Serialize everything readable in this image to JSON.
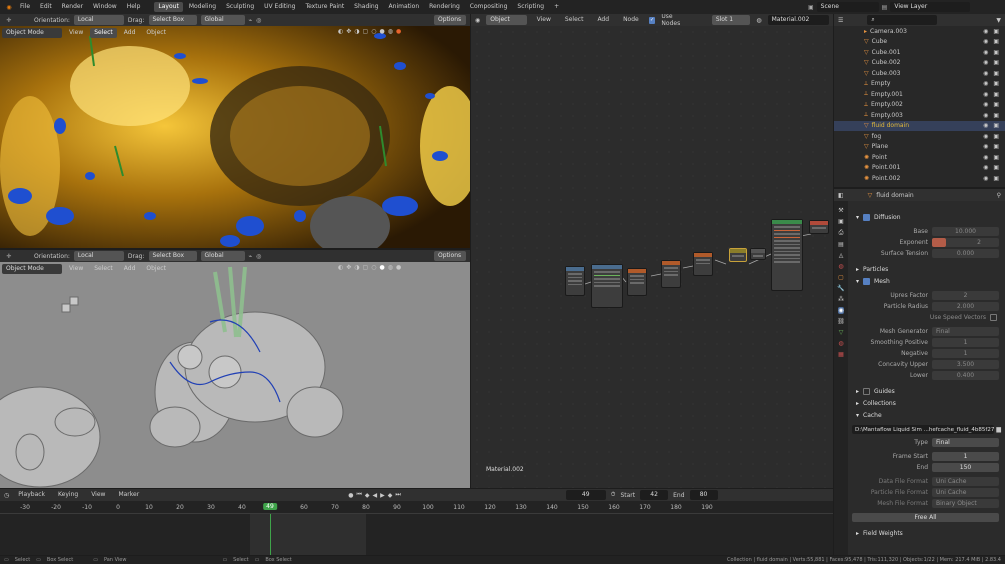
{
  "topbar": {
    "menus": [
      "File",
      "Edit",
      "Render",
      "Window",
      "Help"
    ],
    "workspaces": [
      "Layout",
      "Modeling",
      "Sculpting",
      "UV Editing",
      "Texture Paint",
      "Shading",
      "Animation",
      "Rendering",
      "Compositing",
      "Scripting"
    ],
    "active": "Layout",
    "scene": "Scene",
    "view_layer": "View Layer"
  },
  "viewport1": {
    "orientation_label": "Orientation:",
    "orientation": "Local",
    "drag_label": "Drag:",
    "drag": "Select Box",
    "transform": "Global",
    "options": "Options",
    "mode": "Object Mode",
    "menus": [
      "View",
      "Select",
      "Add",
      "Object"
    ]
  },
  "viewport2": {
    "orientation_label": "Orientation:",
    "orientation": "Local",
    "drag_label": "Drag:",
    "drag": "Select Box",
    "transform": "Global",
    "options": "Options",
    "mode": "Object Mode",
    "menus": [
      "View",
      "Select",
      "Add",
      "Object"
    ]
  },
  "node_editor": {
    "type": "Object",
    "menus": [
      "View",
      "Select",
      "Add",
      "Node"
    ],
    "use_nodes": "Use Nodes",
    "slot": "Slot 1",
    "material": "Material.002",
    "footer_label": "Material.002"
  },
  "outliner": {
    "items": [
      {
        "name": "Camera.003"
      },
      {
        "name": "Cube"
      },
      {
        "name": "Cube.001"
      },
      {
        "name": "Cube.002"
      },
      {
        "name": "Cube.003"
      },
      {
        "name": "Empty"
      },
      {
        "name": "Empty.001"
      },
      {
        "name": "Empty.002"
      },
      {
        "name": "Empty.003"
      },
      {
        "name": "fluid domain",
        "selected": true
      },
      {
        "name": "fog"
      },
      {
        "name": "Plane"
      },
      {
        "name": "Point"
      },
      {
        "name": "Point.001"
      },
      {
        "name": "Point.002"
      }
    ]
  },
  "properties": {
    "object_name": "fluid domain",
    "diffusion": {
      "title": "Diffusion",
      "base_label": "Base",
      "base": "10.000",
      "exponent_label": "Exponent",
      "exponent": "2",
      "surface_tension_label": "Surface Tension",
      "surface_tension": "0.000"
    },
    "particles": "Particles",
    "mesh": {
      "title": "Mesh",
      "upres_label": "Upres Factor",
      "upres": "2",
      "radius_label": "Particle Radius",
      "radius": "2.000",
      "speed_vectors": "Use Speed Vectors",
      "generator_label": "Mesh Generator",
      "generator": "Final",
      "smoothing_pos_label": "Smoothing Positive",
      "smoothing_pos": "1",
      "negative_label": "Negative",
      "negative": "1",
      "concavity_upper_label": "Concavity Upper",
      "concavity_upper": "3.500",
      "lower_label": "Lower",
      "lower": "0.400"
    },
    "guides": "Guides",
    "collections": "Collections",
    "cache": {
      "title": "Cache",
      "path": "D:\\Mantaflow Liquid Sim ...hefcache_fluid_4b85f272",
      "type_label": "Type",
      "type": "Final",
      "frame_start_label": "Frame Start",
      "frame_start": "1",
      "end_label": "End",
      "end": "150",
      "data_format_label": "Data File Format",
      "data_format": "Uni Cache",
      "particle_format_label": "Particle File Format",
      "particle_format": "Uni Cache",
      "mesh_format_label": "Mesh File Format",
      "mesh_format": "Binary Object",
      "free_all": "Free All"
    },
    "field_weights": "Field Weights"
  },
  "timeline": {
    "menus": [
      "Playback",
      "Keying",
      "View",
      "Marker"
    ],
    "current_frame": "49",
    "start_label": "Start",
    "start": "42",
    "end_label": "End",
    "end": "80",
    "ticks": [
      "-30",
      "-20",
      "-10",
      "0",
      "10",
      "20",
      "30",
      "40",
      "49",
      "60",
      "70",
      "80",
      "90",
      "100",
      "110",
      "120",
      "130",
      "140",
      "150",
      "160",
      "170",
      "180",
      "190"
    ]
  },
  "status": {
    "left": [
      "Select",
      "Box Select",
      "Pan View",
      "Select",
      "Box Select"
    ],
    "right": "Collection | fluid domain | Verts:55,881 | Faces:95,478 | Tris:111,320 | Objects:1/22 | Mem: 217.4 MiB | 2.83.4"
  }
}
